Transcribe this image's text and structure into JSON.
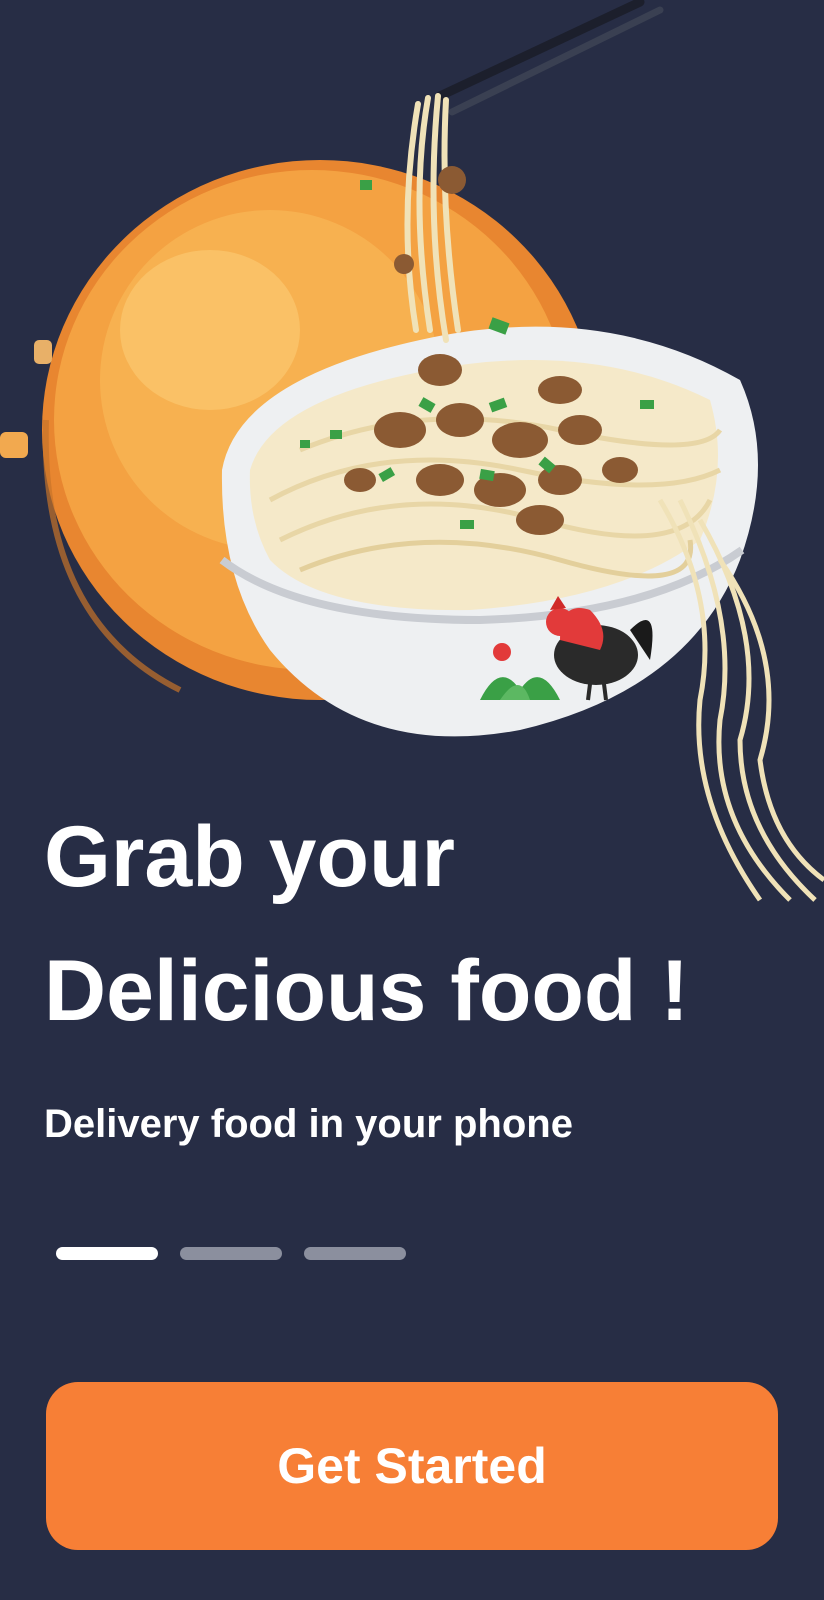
{
  "onboarding": {
    "headline_line1": "Grab your",
    "headline_line2": "Delicious food !",
    "subtitle": "Delivery food in your phone",
    "cta_label": "Get Started",
    "pager": {
      "total": 3,
      "active_index": 0
    }
  },
  "colors": {
    "background": "#272d45",
    "accent": "#f77f36",
    "text": "#ffffff",
    "pager_inactive": "#8b8f9e",
    "pager_active": "#ffffff"
  },
  "hero": {
    "illustration": "noodle-bowl-illustration"
  }
}
